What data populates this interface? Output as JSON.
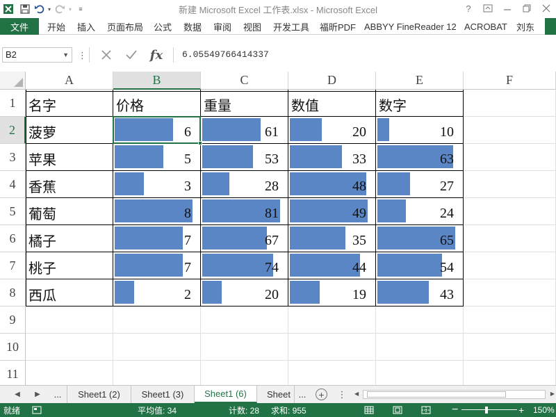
{
  "window": {
    "title": "新建 Microsoft Excel 工作表.xlsx - Microsoft Excel",
    "help_label": "?"
  },
  "ribbon": {
    "file_label": "文件",
    "tabs": [
      "开始",
      "插入",
      "页面布局",
      "公式",
      "数据",
      "审阅",
      "视图",
      "开发工具",
      "福昕PDF",
      "ABBYY FineReader 12",
      "ACROBAT",
      "刘东"
    ]
  },
  "formula_bar": {
    "name_box": "B2",
    "formula": "6.05549766414337",
    "fx_label": "fx"
  },
  "grid": {
    "columns": [
      "A",
      "B",
      "C",
      "D",
      "E",
      "F"
    ],
    "rows": [
      "1",
      "2",
      "3",
      "4",
      "5",
      "6",
      "7",
      "8",
      "9",
      "10",
      "11"
    ],
    "selected_cell": "B2",
    "headers": [
      "名字",
      "价格",
      "重量",
      "数值",
      "数字"
    ],
    "data": [
      {
        "name": "菠萝",
        "price": 6,
        "weight": 61,
        "value": 20,
        "number": 10
      },
      {
        "name": "苹果",
        "price": 5,
        "weight": 53,
        "value": 33,
        "number": 63
      },
      {
        "name": "香蕉",
        "price": 3,
        "weight": 28,
        "value": 48,
        "number": 27
      },
      {
        "name": "葡萄",
        "price": 8,
        "weight": 81,
        "value": 49,
        "number": 24
      },
      {
        "name": "橘子",
        "price": 7,
        "weight": 67,
        "value": 35,
        "number": 65
      },
      {
        "name": "桃子",
        "price": 7,
        "weight": 74,
        "value": 44,
        "number": 54
      },
      {
        "name": "西瓜",
        "price": 2,
        "weight": 20,
        "value": 19,
        "number": 43
      }
    ],
    "databar_color": "#5b86c5"
  },
  "sheets": {
    "ellipsis_left": "...",
    "tabs": [
      "Sheet1 (2)",
      "Sheet1 (3)",
      "Sheet1 (6)",
      "Sheet"
    ],
    "active_index": 2,
    "ellipsis_right": "..."
  },
  "status": {
    "ready": "就绪",
    "average": "平均值: 34",
    "count": "计数: 28",
    "sum": "求和: 955",
    "zoom": "150%"
  },
  "colors": {
    "accent": "#217346"
  }
}
